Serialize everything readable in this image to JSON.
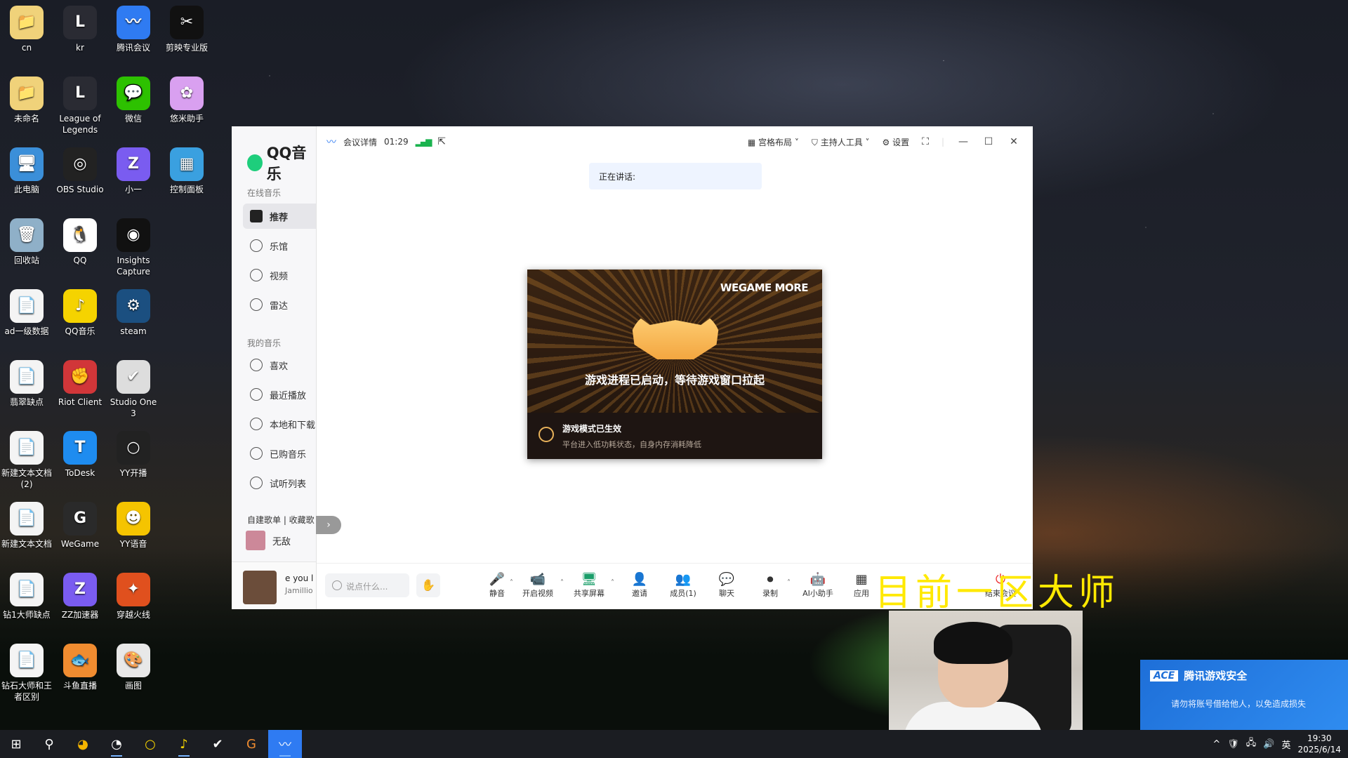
{
  "desktop": {
    "icons": [
      {
        "label": "cn",
        "glyph": "📁",
        "bg": "#f0d27a"
      },
      {
        "label": "kr",
        "glyph": "L",
        "bg": "#2a2b33"
      },
      {
        "label": "腾讯会议",
        "glyph": "〰",
        "bg": "#2f7bf2"
      },
      {
        "label": "剪映专业版",
        "glyph": "✂",
        "bg": "#111111"
      },
      {
        "label": "未命名",
        "glyph": "📁",
        "bg": "#f0d27a"
      },
      {
        "label": "League of Legends",
        "glyph": "L",
        "bg": "#2a2b33"
      },
      {
        "label": "微信",
        "glyph": "💬",
        "bg": "#2dc100"
      },
      {
        "label": "悠米助手",
        "glyph": "✿",
        "bg": "#d9a0f0"
      },
      {
        "label": "此电脑",
        "glyph": "🖥",
        "bg": "#3b8fd9"
      },
      {
        "label": "OBS Studio",
        "glyph": "◎",
        "bg": "#222222"
      },
      {
        "label": "小一",
        "glyph": "Z",
        "bg": "#7a5cf0"
      },
      {
        "label": "控制面板",
        "glyph": "▦",
        "bg": "#3aa0e0"
      },
      {
        "label": "回收站",
        "glyph": "🗑",
        "bg": "#8fb0c8"
      },
      {
        "label": "QQ",
        "glyph": "🐧",
        "bg": "#ffffff"
      },
      {
        "label": "Insights Capture",
        "glyph": "◉",
        "bg": "#111111"
      },
      {
        "label": "",
        "glyph": "",
        "bg": "transparent"
      },
      {
        "label": "ad一级数据",
        "glyph": "📄",
        "bg": "#f4f4f4"
      },
      {
        "label": "QQ音乐",
        "glyph": "♪",
        "bg": "#f5d300"
      },
      {
        "label": "steam",
        "glyph": "⚙",
        "bg": "#1b4f80"
      },
      {
        "label": "",
        "glyph": "",
        "bg": "transparent"
      },
      {
        "label": "翡翠缺点",
        "glyph": "📄",
        "bg": "#f4f4f4"
      },
      {
        "label": "Riot Client",
        "glyph": "✊",
        "bg": "#d13639"
      },
      {
        "label": "Studio One 3",
        "glyph": "✔",
        "bg": "#dddddd"
      },
      {
        "label": "",
        "glyph": "",
        "bg": "transparent"
      },
      {
        "label": "新建文本文档 (2)",
        "glyph": "📄",
        "bg": "#f4f4f4"
      },
      {
        "label": "ToDesk",
        "glyph": "T",
        "bg": "#1e8cf0"
      },
      {
        "label": "YY开播",
        "glyph": "○",
        "bg": "#222222"
      },
      {
        "label": "",
        "glyph": "",
        "bg": "transparent"
      },
      {
        "label": "新建文本文档",
        "glyph": "📄",
        "bg": "#f4f4f4"
      },
      {
        "label": "WeGame",
        "glyph": "G",
        "bg": "#2a2a2a"
      },
      {
        "label": "YY语音",
        "glyph": "☻",
        "bg": "#f5c400"
      },
      {
        "label": "",
        "glyph": "",
        "bg": "transparent"
      },
      {
        "label": "钻1大师缺点",
        "glyph": "📄",
        "bg": "#f4f4f4"
      },
      {
        "label": "ZZ加速器",
        "glyph": "Z",
        "bg": "#7a5cf0"
      },
      {
        "label": "穿越火线",
        "glyph": "✦",
        "bg": "#e0501e"
      },
      {
        "label": "",
        "glyph": "",
        "bg": "transparent"
      },
      {
        "label": "钻石大师和王者区别",
        "glyph": "📄",
        "bg": "#f4f4f4"
      },
      {
        "label": "斗鱼直播",
        "glyph": "🐟",
        "bg": "#f08c30"
      },
      {
        "label": "画图",
        "glyph": "🎨",
        "bg": "#e8e8e8"
      }
    ]
  },
  "qqmusic": {
    "logo": "QQ音乐",
    "section_online": "在线音乐",
    "nav_online": [
      "推荐",
      "乐馆",
      "视频",
      "雷达"
    ],
    "section_mine": "我的音乐",
    "nav_mine": [
      "喜欢",
      "最近播放",
      "本地和下载",
      "已购音乐",
      "试听列表"
    ],
    "playlist_tabs": "自建歌单 | 收藏歌",
    "playlist_item": "无敌",
    "now_playing_title": "e you l",
    "now_playing_artist": "Jamillio"
  },
  "meeting": {
    "details": "会议详情",
    "timer": "01:29",
    "signal": "▂▄▆",
    "layout": "宫格布局",
    "host_tools": "主持人工具",
    "settings": "设置",
    "speaking": "正在讲话:",
    "chat_placeholder": "说点什么...",
    "toolbar": [
      "静音",
      "开启视频",
      "共享屏幕",
      "邀请",
      "成员(1)",
      "聊天",
      "录制",
      "AI小助手",
      "应用",
      "结束会议"
    ],
    "toolbar_icons": [
      "🎤",
      "📹",
      "🖥",
      "👤",
      "👥",
      "💬",
      "⏺",
      "🤖",
      "▦",
      "⏻"
    ]
  },
  "game_card": {
    "brand": "WEGAME MORE",
    "status": "游戏进程已启动，等待游戏窗口拉起",
    "mode_title": "游戏模式已生效",
    "mode_desc": "平台进入低功耗状态，自身内存消耗降低"
  },
  "overlay_text": "目前一区大师",
  "toast": {
    "logo": "ACE",
    "title": "腾讯游戏安全",
    "message": "请勿将账号借给他人，以免造成损失"
  },
  "taskbar": {
    "icons": [
      "⊞",
      "⚲",
      "◕",
      "◔",
      "○",
      "♪",
      "✔",
      "G",
      "〰"
    ],
    "tray": [
      "^",
      "🛡",
      "🖧",
      "🔊",
      "英"
    ],
    "time": "19:30",
    "date": "2025/6/14"
  }
}
